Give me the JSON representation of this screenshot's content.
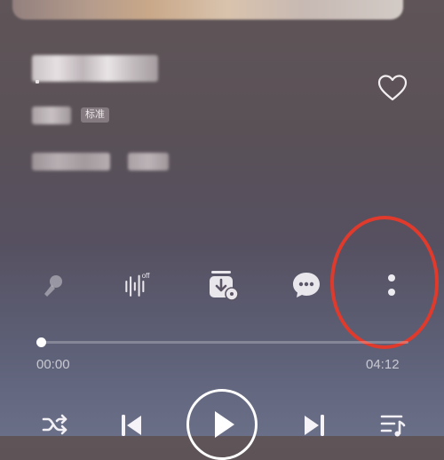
{
  "song": {
    "quality_badge": "标准"
  },
  "actions": {
    "singalong_icon": "microphone-icon",
    "sound_effect_icon": "sound-effect-off-icon",
    "sound_effect_state": "off",
    "download_icon": "download-icon",
    "comment_icon": "comment-icon",
    "more_icon": "more-vertical-icon"
  },
  "progress": {
    "elapsed": "00:00",
    "total": "04:12",
    "fraction": 0.0
  },
  "controls": {
    "shuffle_icon": "shuffle-icon",
    "prev_icon": "previous-icon",
    "play_icon": "play-icon",
    "next_icon": "next-icon",
    "playlist_icon": "playlist-icon"
  },
  "colors": {
    "annotation": "#e03a2d",
    "accent": "#ffffff"
  }
}
